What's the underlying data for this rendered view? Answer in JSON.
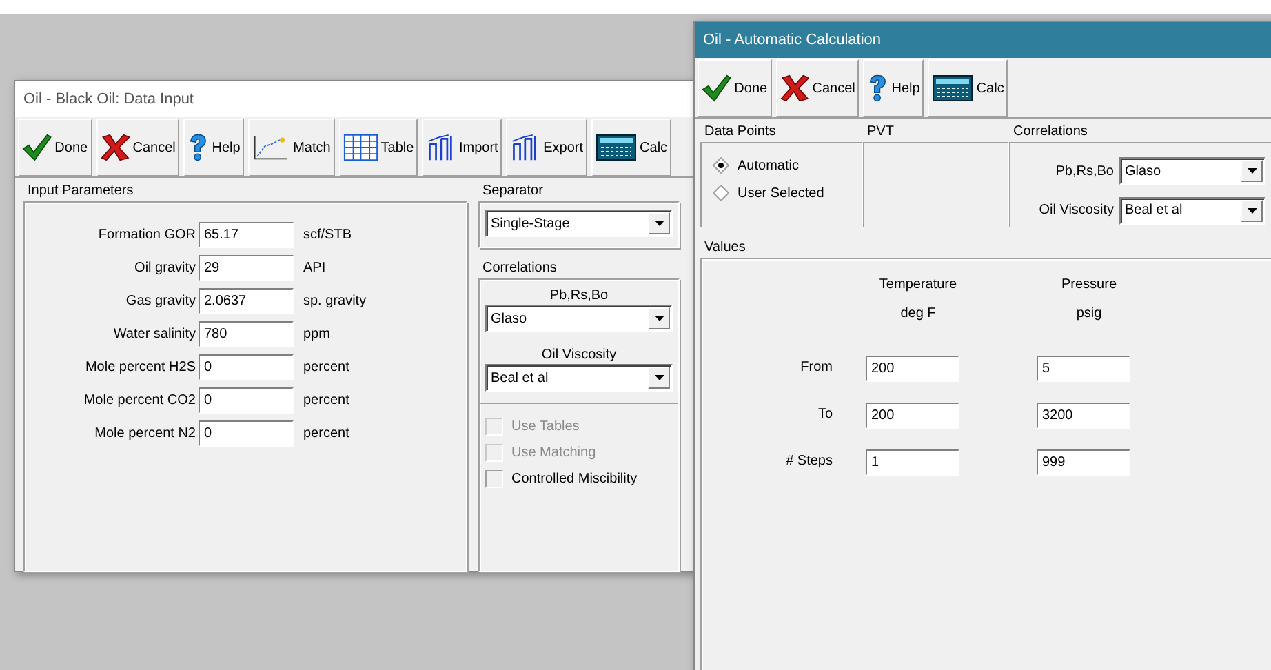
{
  "windows": [
    {
      "kind": "data_input",
      "title": "Oil - Black Oil: Data Input",
      "active": false,
      "toolbar": [
        {
          "kind": "done",
          "label": "Done"
        },
        {
          "kind": "cancel",
          "label": "Cancel"
        },
        {
          "kind": "help",
          "label": "Help"
        },
        {
          "kind": "match",
          "label": "Match"
        },
        {
          "kind": "table",
          "label": "Table"
        },
        {
          "kind": "import",
          "label": "Import"
        },
        {
          "kind": "export",
          "label": "Export"
        },
        {
          "kind": "calc",
          "label": "Calc"
        }
      ],
      "input_parameters": {
        "title": "Input Parameters",
        "rows": [
          {
            "label": "Formation GOR",
            "value": "65.17",
            "unit": "scf/STB"
          },
          {
            "label": "Oil gravity",
            "value": "29",
            "unit": "API"
          },
          {
            "label": "Gas gravity",
            "value": "2.0637",
            "unit": "sp. gravity"
          },
          {
            "label": "Water salinity",
            "value": "780",
            "unit": "ppm"
          },
          {
            "label": "Mole percent H2S",
            "value": "0",
            "unit": "percent"
          },
          {
            "label": "Mole percent CO2",
            "value": "0",
            "unit": "percent"
          },
          {
            "label": "Mole percent N2",
            "value": "0",
            "unit": "percent"
          }
        ]
      },
      "separator": {
        "title": "Separator",
        "value": "Single-Stage"
      },
      "correlations": {
        "title": "Correlations",
        "rows": [
          {
            "label": "Pb,Rs,Bo",
            "value": "Glaso"
          },
          {
            "label": "Oil Viscosity",
            "value": "Beal et al"
          }
        ]
      },
      "options": [
        {
          "label": "Use Tables",
          "checked": false,
          "disabled": true
        },
        {
          "label": "Use Matching",
          "checked": false,
          "disabled": true
        },
        {
          "label": "Controlled Miscibility",
          "checked": false,
          "disabled": false
        }
      ]
    },
    {
      "kind": "auto_calc",
      "title": "Oil - Automatic Calculation",
      "active": true,
      "toolbar": [
        {
          "kind": "done",
          "label": "Done"
        },
        {
          "kind": "cancel",
          "label": "Cancel"
        },
        {
          "kind": "help",
          "label": "Help"
        },
        {
          "kind": "calc",
          "label": "Calc"
        }
      ],
      "data_points": {
        "title": "Data Points",
        "options": [
          {
            "label": "Automatic",
            "selected": true
          },
          {
            "label": "User Selected",
            "selected": false
          }
        ]
      },
      "pvt": {
        "title": "PVT"
      },
      "correlations": {
        "title": "Correlations",
        "rows": [
          {
            "label": "Pb,Rs,Bo",
            "value": "Glaso"
          },
          {
            "label": "Oil Viscosity",
            "value": "Beal et al"
          }
        ]
      },
      "values": {
        "title": "Values",
        "columns": [
          {
            "name": "Temperature",
            "unit": "deg F"
          },
          {
            "name": "Pressure",
            "unit": "psig"
          }
        ],
        "rows": [
          {
            "label": "From",
            "values": [
              "200",
              "5"
            ]
          },
          {
            "label": "To",
            "values": [
              "200",
              "3200"
            ]
          },
          {
            "label": "# Steps",
            "values": [
              "1",
              "999"
            ]
          }
        ]
      }
    }
  ]
}
